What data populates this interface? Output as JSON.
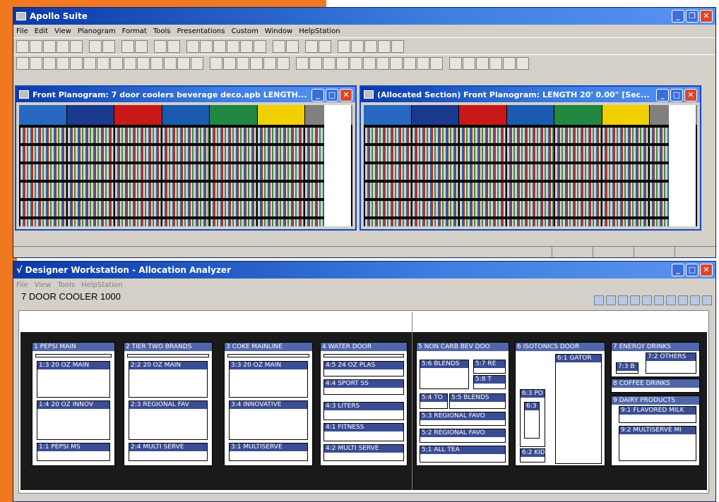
{
  "app": {
    "title": "Apollo Suite",
    "menus": [
      "File",
      "Edit",
      "View",
      "Planogram",
      "Format",
      "Tools",
      "Presentations",
      "Custom",
      "Window",
      "HelpStation"
    ]
  },
  "child1": {
    "title": "Front Planogram: 7 door coolers beverage deco.apb LENGTH..."
  },
  "child2": {
    "title": "(Allocated Section) Front Planogram:  LENGTH 20' 0.00\" [Sec..."
  },
  "door_headers": [
    "#2868c0",
    "#1a3a90",
    "#c81818",
    "#1a5ab0",
    "#208840",
    "#f0d000",
    "#808080"
  ],
  "dw": {
    "title": "Designer Workstation - Allocation Analyzer",
    "menus": [
      "File",
      "View",
      "Tools",
      "HelpStation"
    ],
    "section": "7 DOOR COOLER 1000"
  },
  "bays": [
    {
      "label": "1 PEPSI MAIN",
      "subs": [
        "1:3 20 OZ MAIN",
        "1:4 20 OZ INNOV",
        "1:1 PEPSI MS"
      ]
    },
    {
      "label": "2 TIER TWO BRANDS",
      "subs": [
        "2:2 20 OZ MAIN",
        "2:3 REGIONAL FAV",
        "2:4 MULTI SERVE"
      ]
    },
    {
      "label": "3 COKE MAINLINE",
      "subs": [
        "3:3 20 OZ MAIN",
        "3:4 INNOVATIVE",
        "3:1 MULTISERVE"
      ]
    },
    {
      "label": "4 WATER DOOR",
      "subs": [
        "4:5 24 OZ PLAS",
        "4:4 SPORT SS",
        "4:3 LITERS",
        "4:1 FITNESS",
        "4:2 MULTI SERVE"
      ]
    },
    {
      "label": "5 NON CARB BEV DOO",
      "subs": [
        "5:6 BLENDS",
        "5:7 RE",
        "5:8 T",
        "5:4 TO",
        "5:5 BLENDS",
        "5:3 REGIONAL FAVO",
        "5:2 REGIONAL FAVO",
        "5:1 ALL TEA"
      ]
    },
    {
      "label": "6 ISOTONICS DOOR",
      "subs": [
        "6:1 GATOR",
        "6:3 PO",
        "6:3",
        "6:2 KID"
      ]
    },
    {
      "label": "7 ENERGY DRINKS",
      "subs": [
        "7:2 OTHERS",
        "7:3 B"
      ]
    },
    {
      "label": "8 COFFEE DRINKS",
      "subs": []
    },
    {
      "label": "9 DAIRY PRODUCTS",
      "subs": [
        "9:1 FLAVORED MILK",
        "9:2 MULTISERVE MI"
      ]
    }
  ]
}
